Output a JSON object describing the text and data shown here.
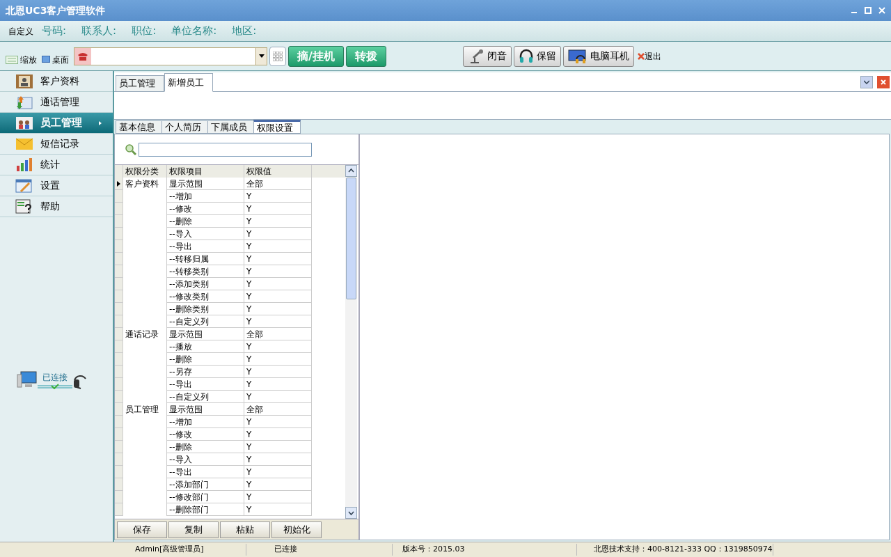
{
  "window": {
    "title": "北恩UC3客户管理软件"
  },
  "query_bar": {
    "custom": "自定义",
    "fields": [
      "号码:",
      "联系人:",
      "职位:",
      "单位名称:",
      "地区:"
    ]
  },
  "toolbar": {
    "zoom": "缩放",
    "desktop": "桌面",
    "dial_buttons": [
      "摘/挂机",
      "转拨"
    ],
    "call_buttons": [
      {
        "kind": "mic",
        "label": "闭音"
      },
      {
        "kind": "headset",
        "label": "保留"
      },
      {
        "kind": "pc",
        "label": "电脑耳机"
      }
    ],
    "exit": "退出"
  },
  "sidebar": {
    "items": [
      {
        "kind": "contacts",
        "label": "客户资料",
        "selected": false
      },
      {
        "kind": "calls",
        "label": "通话管理",
        "selected": false
      },
      {
        "kind": "staff",
        "label": "员工管理",
        "selected": true
      },
      {
        "kind": "sms",
        "label": "短信记录",
        "selected": false
      },
      {
        "kind": "stats",
        "label": "统计",
        "selected": false
      },
      {
        "kind": "settings",
        "label": "设置",
        "selected": false
      },
      {
        "kind": "help",
        "label": "帮助",
        "selected": false
      }
    ],
    "connection": "已连接"
  },
  "tabs": [
    {
      "label": "员工管理",
      "selected": false
    },
    {
      "label": "新增员工",
      "selected": true
    }
  ],
  "sub_tabs": [
    {
      "label": "基本信息",
      "selected": false
    },
    {
      "label": "个人简历",
      "selected": false
    },
    {
      "label": "下属成员",
      "selected": false
    },
    {
      "label": "权限设置",
      "selected": true
    }
  ],
  "permissions": {
    "columns": [
      "权限分类",
      "权限项目",
      "权限值"
    ],
    "groups": [
      {
        "category": "客户资料",
        "rows": [
          {
            "item": "显示范围",
            "value": "全部",
            "selected": true
          },
          {
            "item": "--增加",
            "value": "Y",
            "selected": false
          },
          {
            "item": "--修改",
            "value": "Y",
            "selected": false
          },
          {
            "item": "--删除",
            "value": "Y",
            "selected": false
          },
          {
            "item": "--导入",
            "value": "Y",
            "selected": false
          },
          {
            "item": "--导出",
            "value": "Y",
            "selected": false
          },
          {
            "item": "--转移归属",
            "value": "Y",
            "selected": false
          },
          {
            "item": "--转移类别",
            "value": "Y",
            "selected": false
          },
          {
            "item": "--添加类别",
            "value": "Y",
            "selected": false
          },
          {
            "item": "--修改类别",
            "value": "Y",
            "selected": false
          },
          {
            "item": "--删除类别",
            "value": "Y",
            "selected": false
          },
          {
            "item": "--自定义列",
            "value": "Y",
            "selected": false
          }
        ]
      },
      {
        "category": "通话记录",
        "rows": [
          {
            "item": "显示范围",
            "value": "全部",
            "selected": false
          },
          {
            "item": "--播放",
            "value": "Y",
            "selected": false
          },
          {
            "item": "--删除",
            "value": "Y",
            "selected": false
          },
          {
            "item": "--另存",
            "value": "Y",
            "selected": false
          },
          {
            "item": "--导出",
            "value": "Y",
            "selected": false
          },
          {
            "item": "--自定义列",
            "value": "Y",
            "selected": false
          }
        ]
      },
      {
        "category": "员工管理",
        "rows": [
          {
            "item": "显示范围",
            "value": "全部",
            "selected": false
          },
          {
            "item": "--增加",
            "value": "Y",
            "selected": false
          },
          {
            "item": "--修改",
            "value": "Y",
            "selected": false
          },
          {
            "item": "--删除",
            "value": "Y",
            "selected": false
          },
          {
            "item": "--导入",
            "value": "Y",
            "selected": false
          },
          {
            "item": "--导出",
            "value": "Y",
            "selected": false
          },
          {
            "item": "--添加部门",
            "value": "Y",
            "selected": false
          },
          {
            "item": "--修改部门",
            "value": "Y",
            "selected": false
          },
          {
            "item": "--删除部门",
            "value": "Y",
            "selected": false
          }
        ]
      }
    ],
    "buttons": [
      "保存",
      "复制",
      "粘贴",
      "初始化"
    ]
  },
  "status_bar": [
    "Admin[高级管理员]",
    "已连接",
    "版本号：2015.03",
    "北恩技术支持：400-8121-333 QQ：1319850974"
  ]
}
